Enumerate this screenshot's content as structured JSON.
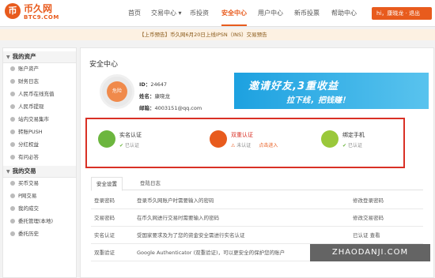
{
  "logo": {
    "mark": "币",
    "name": "币久网",
    "sub": "BTC9.COM"
  },
  "nav": [
    "首页",
    "交易中心 ▾",
    "币投资",
    "安全中心",
    "用户中心",
    "新币投票",
    "帮助中心"
  ],
  "user": {
    "label": "hi，康晓龙 · 退出"
  },
  "notice": "【上币预告】币久网6月20日上线IPSN（INS）交易预告",
  "sidebar": {
    "sections": [
      {
        "label": "我的资产",
        "items": [
          "账户资产",
          "财务日志",
          "人民币在线充值",
          "人民币提现",
          "站内交易集市",
          "转账PUSH",
          "分红权益",
          "有问必答"
        ]
      },
      {
        "label": "我的交易",
        "items": [
          "买币交易",
          "P网交易",
          "我的成交",
          "委托管理(本地)",
          "委托历史"
        ]
      }
    ]
  },
  "main": {
    "title": "安全中心",
    "level": "危险",
    "id_label": "ID：",
    "id_value": "24647",
    "name_label": "姓名：",
    "name_value": "康晓龙",
    "email_label": "邮箱：",
    "email_value": "4003151@qq.com",
    "banner": {
      "line1": "邀请好友,3重收益",
      "num": "3",
      "line2": "拉下线，把钱赚！"
    }
  },
  "cards": [
    {
      "title": "实名认证",
      "status": "已认证",
      "link": "",
      "color": "#6cb63e",
      "icon": "id-card-icon"
    },
    {
      "title": "双重认证",
      "status": "未认证",
      "link": "点击进入",
      "color": "#e85b1d",
      "icon": "shield-icon"
    },
    {
      "title": "绑定手机",
      "status": "已认证",
      "link": "",
      "color": "#9ac83a",
      "icon": "phone-icon"
    }
  ],
  "tabs": [
    "安全设置",
    "登陆日志"
  ],
  "table": [
    {
      "name": "登录密码",
      "desc": "登录币久网账户时需要输入的密码",
      "action": "修改登录密码"
    },
    {
      "name": "交易密码",
      "desc": "在币久网进行交易时需要输入的密码",
      "action": "修改交易密码"
    },
    {
      "name": "实名认证",
      "desc": "受国家要求及为了您的资金安全需进行实名认证",
      "action": "已认证 查看"
    },
    {
      "name": "双重验证",
      "desc": "Google Authenticator (双重验证)，可以更安全的保护您的账户",
      "action": ""
    }
  ],
  "watermark": "ZHAODANJI.COM"
}
